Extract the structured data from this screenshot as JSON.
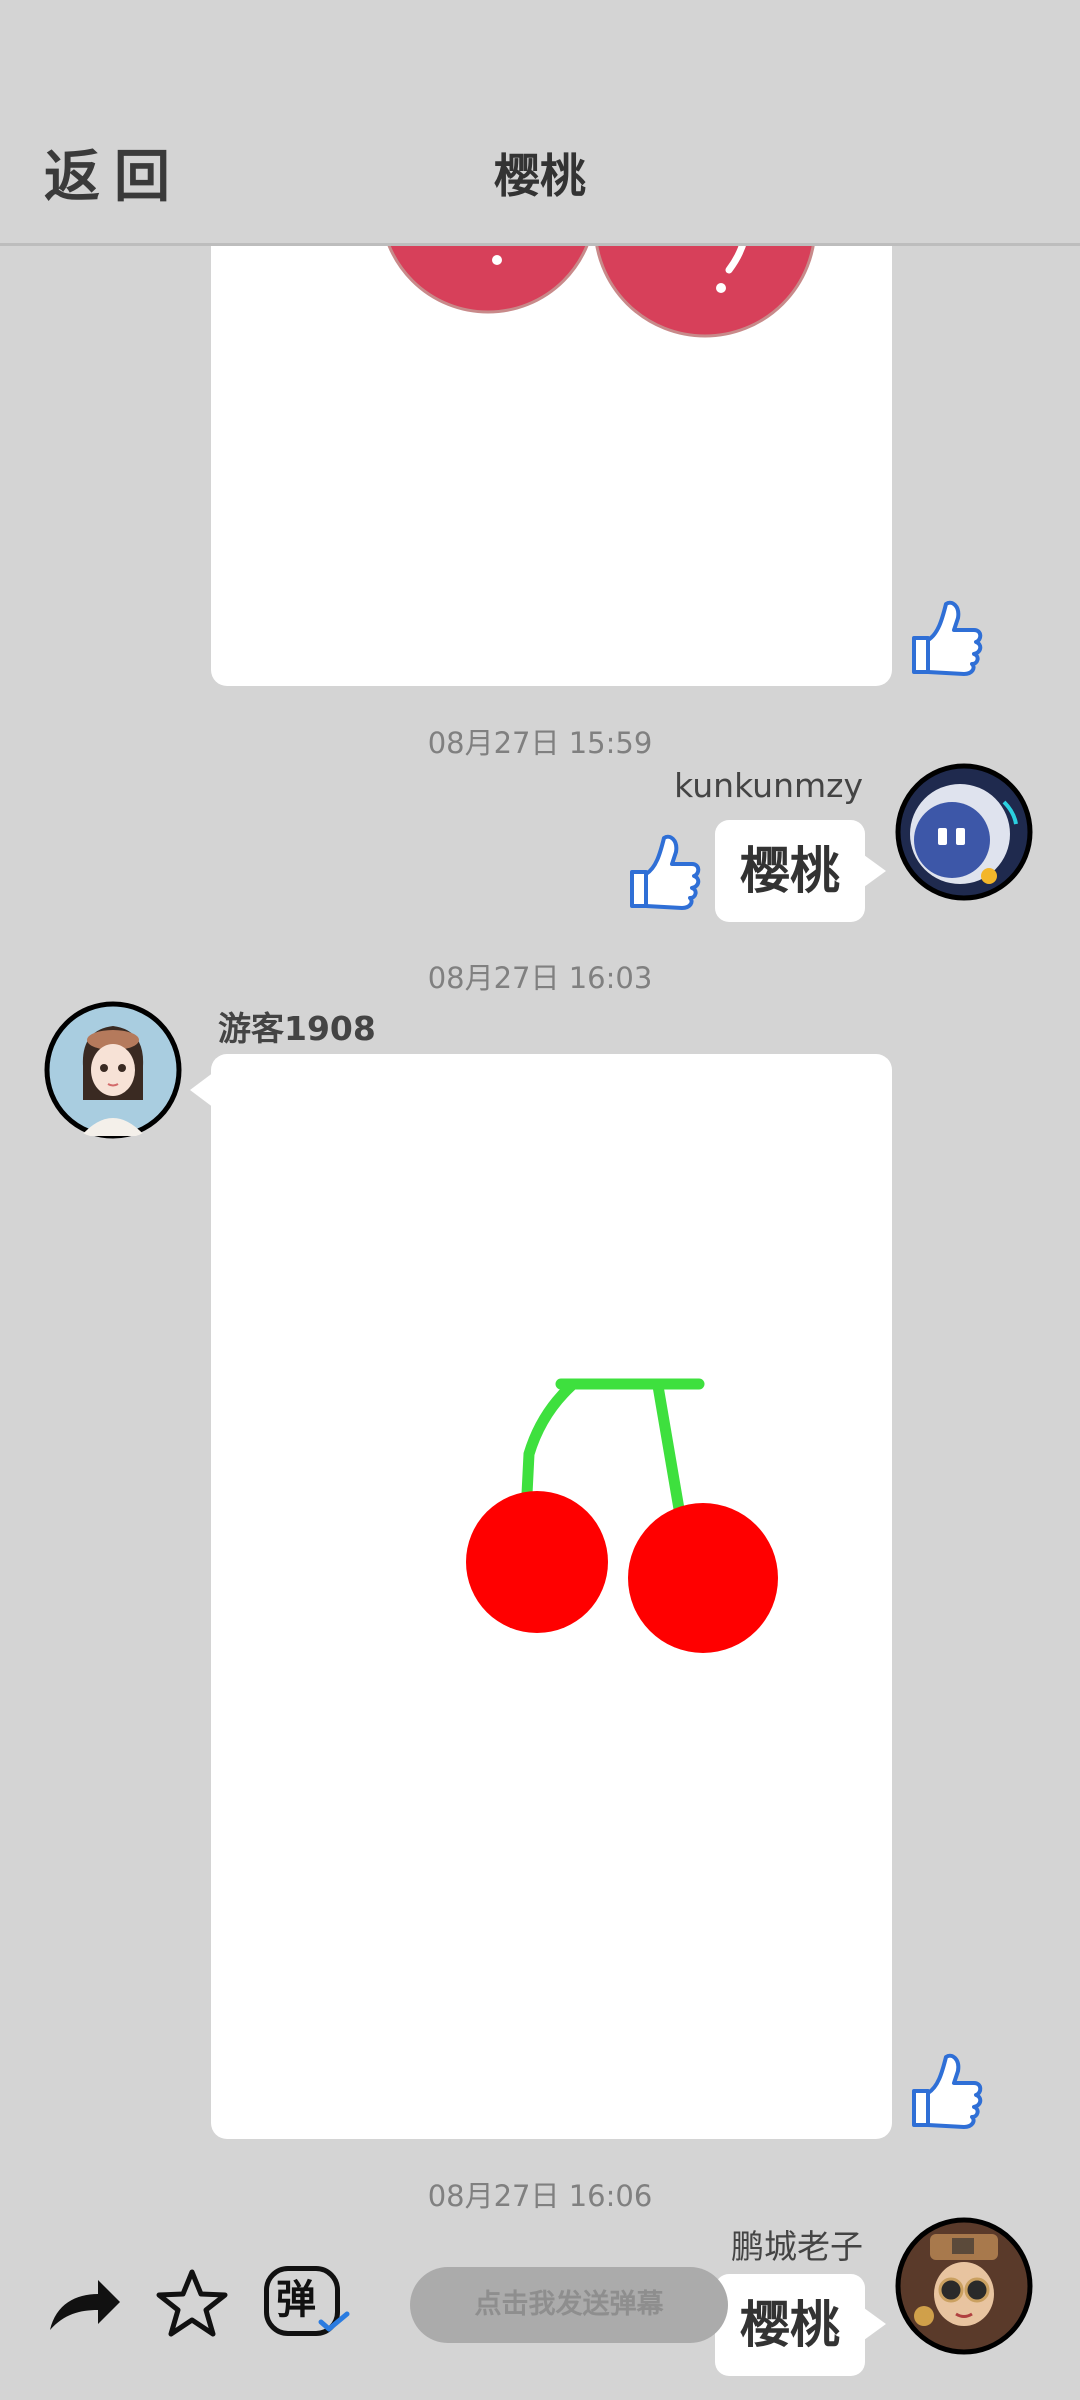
{
  "header": {
    "back_label": "返回",
    "title": "樱桃"
  },
  "messages": [
    {
      "timestamp": "08月27日  15:59",
      "username": "kunkunmzy",
      "text": "樱桃"
    },
    {
      "timestamp": "08月27日  16:03",
      "username": "游客1908"
    },
    {
      "timestamp": "08月27日  16:06",
      "username": "鹏城老子",
      "text": "樱桃"
    }
  ],
  "bottom_bar": {
    "danmu_placeholder": "点击我发送弹幕",
    "danmu_icon_char": "弹"
  },
  "colors": {
    "background": "#d4d4d4",
    "like_blue": "#2f6fd6",
    "cherry_red_drawn": "#ff0000",
    "cherry_stem_green": "#3ee03e",
    "cherry_red_top": "#d7405a"
  }
}
